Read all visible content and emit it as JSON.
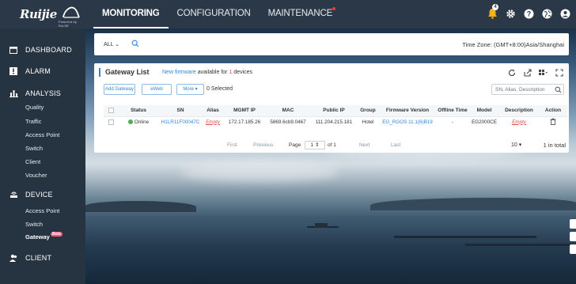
{
  "brand": {
    "logo_text": "Ruijie",
    "logo_sub": "Powered by RuiJIE"
  },
  "nav": {
    "items": [
      {
        "label": "MONITORING"
      },
      {
        "label": "CONFIGURATION"
      },
      {
        "label": "MAINTENANCE"
      }
    ],
    "notification_count": "4"
  },
  "sidebar": {
    "dashboard": "DASHBOARD",
    "alarm": "ALARM",
    "analysis": "ANALYSIS",
    "analysis_items": [
      "Quality",
      "Traffic",
      "Access Point",
      "Switch",
      "Client",
      "Voucher"
    ],
    "device": "DEVICE",
    "device_items": [
      "Access Point",
      "Switch",
      "Gateway"
    ],
    "beta": "Beta",
    "client": "CLIENT"
  },
  "filter": {
    "group": "ALL",
    "timezone": "Time Zone: (GMT+8:00)Asia/Shanghai"
  },
  "panel": {
    "title": "Gateway List",
    "fw_link": "New firmware",
    "fw_mid": " available for ",
    "fw_count": "1",
    "fw_suffix": " devices",
    "add_btn": "Add Gateway",
    "eweb_btn": "eWeb",
    "more_btn": "More",
    "selected": "0 Selected",
    "search_placeholder": "SN, Alias, Description"
  },
  "table": {
    "columns": [
      "Status",
      "SN",
      "Alias",
      "MGMT IP",
      "MAC",
      "Public IP",
      "Group",
      "Firmware Version",
      "Offline Time",
      "Model",
      "Description",
      "Action"
    ],
    "rows": [
      {
        "status": "Online",
        "sn": "H1LR11F00047C",
        "alias": "Empty",
        "mgmt_ip": "172.17.185.26",
        "mac": "5869.6cb9.0467",
        "public_ip": "111.204.215.181",
        "group": "Hotel",
        "firmware": "EG_RGOS 11.1(6)B19",
        "offline_time": "-",
        "model": "EG2000CE",
        "description": "Empty"
      }
    ]
  },
  "pager": {
    "first": "First",
    "previous": "Previous",
    "page_label": "Page",
    "page": "1",
    "of": "of 1",
    "next": "Next",
    "last": "Last",
    "size": "10",
    "total": "1 in total"
  },
  "colors": {
    "accent": "#2f86d9",
    "online": "#4caf50",
    "warn": "#e04a4a",
    "nav_bg": "#2a3847",
    "badge_gold": "#f2b21b"
  },
  "icons": {
    "top": [
      "bell-icon",
      "settings-icon",
      "help-icon",
      "language-icon",
      "user-icon"
    ],
    "tools": [
      "refresh-icon",
      "export-icon",
      "columns-icon",
      "fullscreen-icon"
    ]
  }
}
